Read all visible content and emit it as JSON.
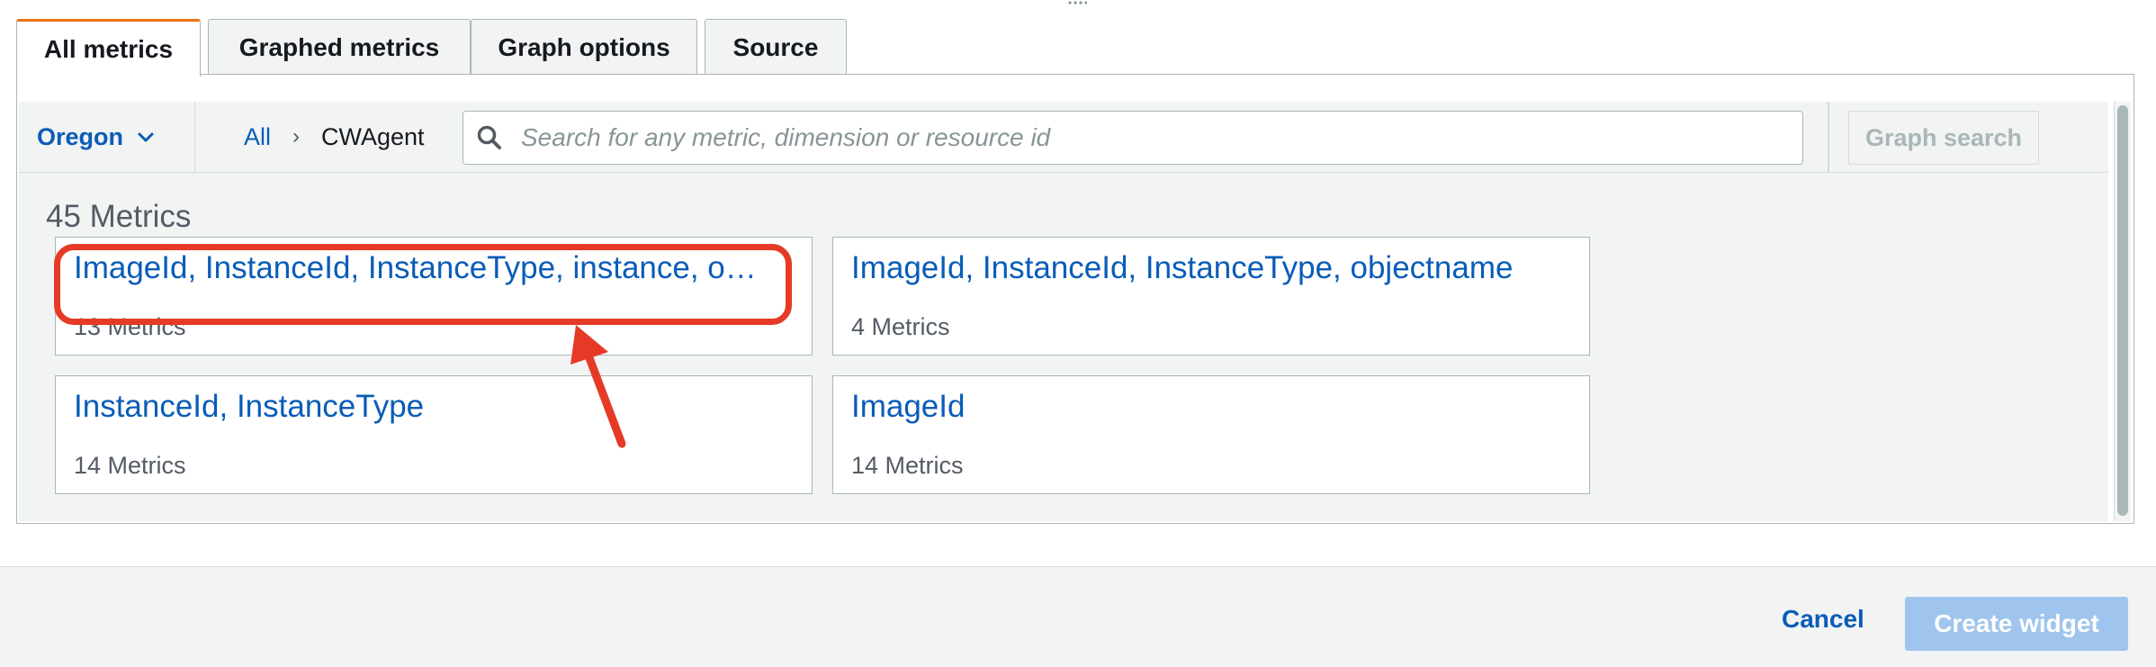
{
  "tabs": [
    {
      "label": "All metrics",
      "active": true
    },
    {
      "label": "Graphed metrics",
      "active": false
    },
    {
      "label": "Graph options",
      "active": false
    },
    {
      "label": "Source",
      "active": false
    }
  ],
  "toolbar": {
    "region": "Oregon",
    "breadcrumb": {
      "root": "All",
      "separator": "›",
      "current": "CWAgent"
    },
    "search_placeholder": "Search for any metric, dimension or resource id",
    "search_value": "",
    "graph_search_label": "Graph search"
  },
  "metrics": {
    "count_label": "45 Metrics",
    "cards": [
      {
        "title": "ImageId, InstanceId, InstanceType, instance, o…",
        "count": "13 Metrics"
      },
      {
        "title": "ImageId, InstanceId, InstanceType, objectname",
        "count": "4 Metrics"
      },
      {
        "title": "InstanceId, InstanceType",
        "count": "14 Metrics"
      },
      {
        "title": "ImageId",
        "count": "14 Metrics"
      }
    ]
  },
  "footer": {
    "cancel_label": "Cancel",
    "create_label": "Create widget"
  },
  "colors": {
    "accent_tab": "#ec7211",
    "link": "#0a5cb8",
    "annotation": "#e53b26",
    "primary_disabled": "#9fc5ee"
  },
  "icons": {
    "region": "chevron-down-icon",
    "search": "search-icon",
    "annotation": "red-arrow-icon"
  }
}
